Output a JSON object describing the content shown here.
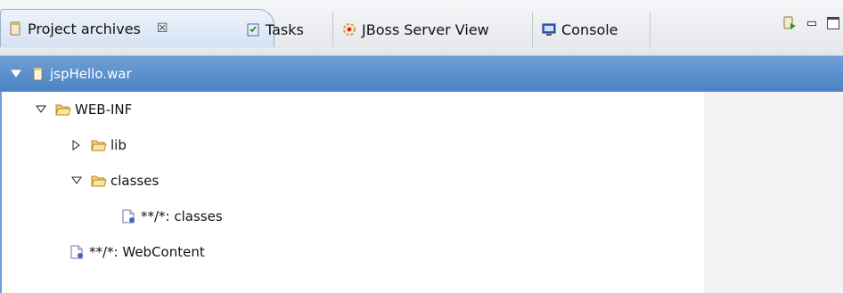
{
  "tabs": [
    {
      "label": "Project archives",
      "close_glyph": "☒",
      "active": true,
      "icon": "archive-jar-icon"
    },
    {
      "label": "Tasks",
      "icon": "tasks-clipboard-icon"
    },
    {
      "label": "JBoss Server View",
      "icon": "jboss-server-icon"
    },
    {
      "label": "Console",
      "icon": "console-monitor-icon"
    }
  ],
  "toolbar": {
    "build_icon": "build-archive-icon",
    "minimize_icon": "minimize-icon",
    "maximize_icon": "maximize-icon"
  },
  "tree": {
    "items": [
      {
        "label": "jspHello.war",
        "icon": "war-jar-icon",
        "expanded": true,
        "selected": true
      },
      {
        "label": "WEB-INF",
        "icon": "folder-open-icon",
        "expanded": true
      },
      {
        "label": "lib",
        "icon": "folder-open-icon",
        "expanded": false
      },
      {
        "label": "classes",
        "icon": "folder-open-icon",
        "expanded": true
      },
      {
        "label": "**/*: classes",
        "icon": "fileset-icon"
      },
      {
        "label": "**/*: WebContent",
        "icon": "fileset-icon"
      }
    ]
  },
  "colors": {
    "selection": "#4b82c4",
    "folder": "#f0b440",
    "tab_active": "#d6e2f3"
  }
}
